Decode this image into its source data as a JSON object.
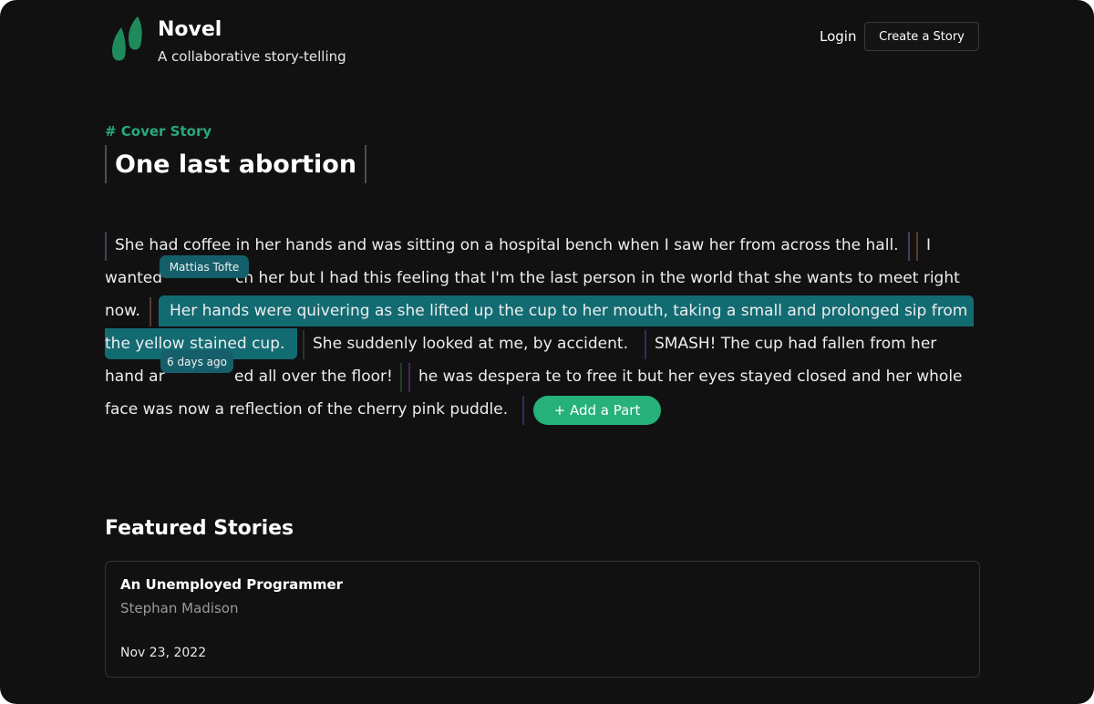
{
  "header": {
    "brand_name": "Novel",
    "brand_tagline": "A collaborative story-telling",
    "login_label": "Login",
    "create_story_label": "Create a Story",
    "logo_icon": "leaf-logo-icon",
    "accent_color": "#26b07a"
  },
  "story": {
    "tag": "# Cover Story",
    "title": "One last abortion",
    "lines": [
      {
        "seg1": "She had coffee in her hands and was sitting on a hospital bench when I saw her from across the hall.",
        "seg2": "I"
      },
      {
        "seg1": "wanted",
        "seg2": "ch her but I had this feeling that I'm the last person in the world that she wants to meet right"
      },
      {
        "seg1": "now.",
        "seg2": "Her hands were quivering as she lifted up the cup to her mouth, taking a small and prolonged sip from"
      },
      {
        "seg1": "the yellow stained cup.",
        "seg2": "She suddenly looked at me, by accident.",
        "seg3": "SMASH! The cup had fallen from her"
      },
      {
        "seg1": "hand ar",
        "seg2": "ed all over the floor!",
        "seg3": "he was despera te to free it but her eyes stayed closed and her whole"
      },
      {
        "seg1": "face was now a reflection of the cherry pink puddle."
      }
    ],
    "tooltip_author": "Mattias Tofte",
    "tooltip_time": "6 days ago",
    "add_part_label": "+ Add a Part",
    "highlight_color": "#136b72"
  },
  "featured": {
    "heading": "Featured Stories",
    "cards": [
      {
        "title": "An Unemployed Programmer",
        "author": "Stephan Madison",
        "date": "Nov 23, 2022"
      }
    ]
  }
}
